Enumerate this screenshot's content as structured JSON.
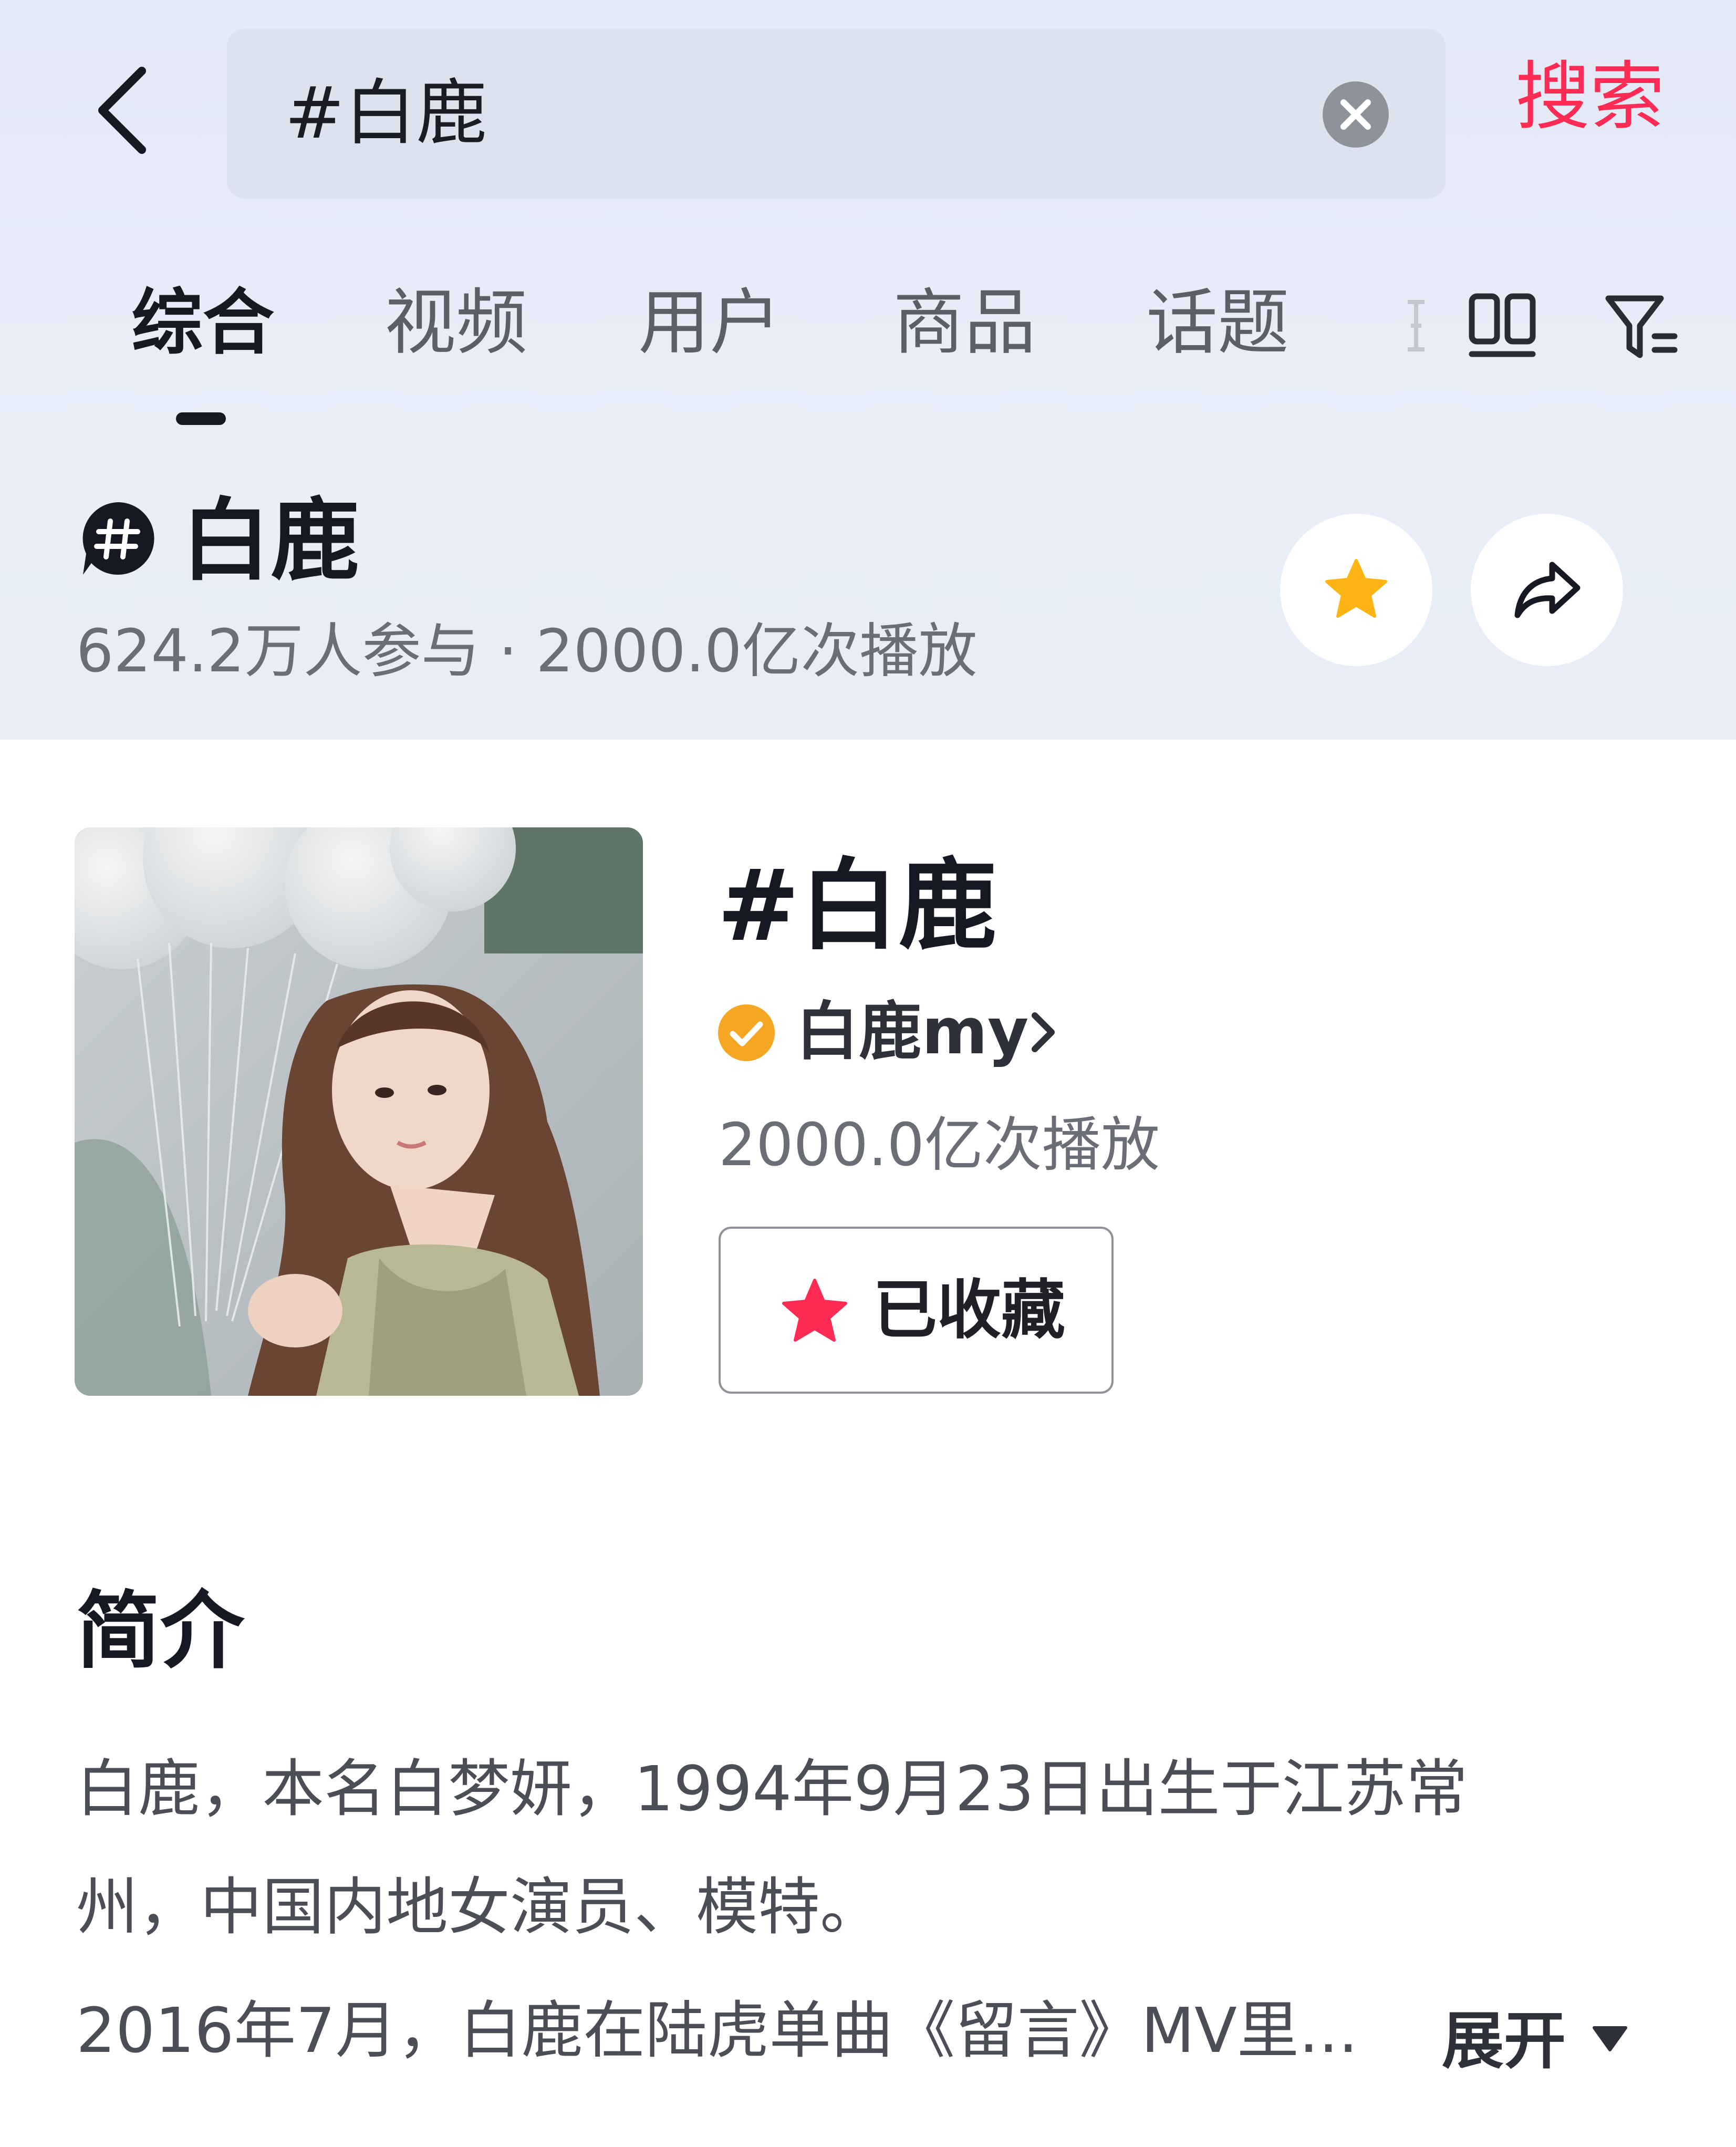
{
  "header": {
    "back_icon": "chevron-left-icon",
    "search_query": "#白鹿",
    "clear_icon": "clear-circle-icon",
    "search_button": "搜索"
  },
  "tabs": {
    "items": [
      "综合",
      "视频",
      "用户",
      "商品",
      "话题"
    ],
    "active": "综合",
    "grid_icon": "double-column-icon",
    "filter_icon": "filter-icon"
  },
  "topic": {
    "hash_icon": "hashtag-bubble-icon",
    "name": "白鹿",
    "stats": "624.2万人参与 · 2000.0亿次播放",
    "favorite_icon": "star-icon",
    "share_icon": "share-arrow-icon"
  },
  "card": {
    "title": "#白鹿",
    "verified_icon": "verified-check-icon",
    "author": "白鹿my",
    "plays": "2000.0亿次播放",
    "collected_label": "已收藏"
  },
  "intro": {
    "title": "简介",
    "lines": [
      "白鹿，本名白梦妍，1994年9月23日出生于江苏常",
      "州，中国内地女演员、模特。",
      "2016年7月，白鹿在陆虎单曲《留言》MV里..."
    ],
    "expand_label": "展开"
  },
  "colors": {
    "accent": "#fe2c55",
    "star_gold": "#fdb515",
    "verified_orange": "#f6a623",
    "top_bg": "#e6ebf7"
  }
}
